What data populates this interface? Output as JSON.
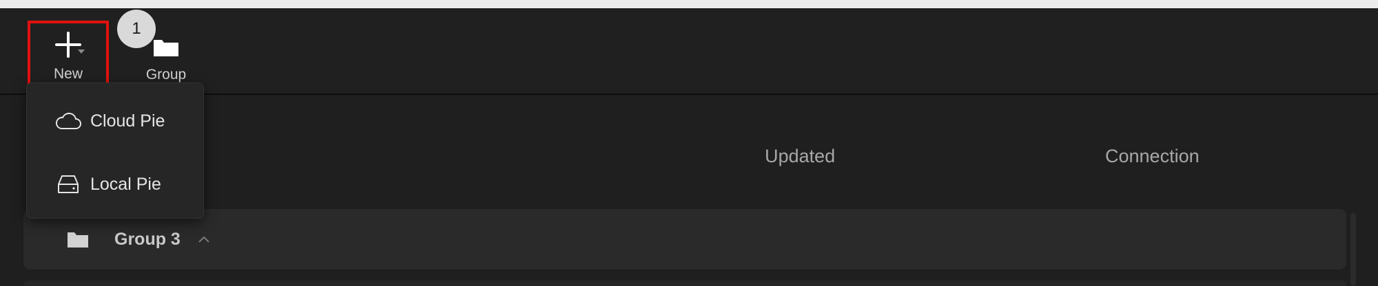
{
  "toolbar": {
    "new_label": "New",
    "group_label": "Group",
    "badge": "1"
  },
  "new_menu": {
    "items": [
      {
        "label": "Cloud Pie",
        "icon": "cloud-icon"
      },
      {
        "label": "Local Pie",
        "icon": "hard-drive-icon"
      }
    ]
  },
  "table": {
    "columns": [
      "Updated",
      "Connection"
    ],
    "groups": [
      {
        "name": "Group 3",
        "icon": "folder-icon",
        "expand_icon": "chevron-up-icon"
      }
    ]
  },
  "colors": {
    "background": "#1f1f1f",
    "highlight": "#e3120f",
    "row": "#2a2a2a",
    "menu": "#262626"
  }
}
